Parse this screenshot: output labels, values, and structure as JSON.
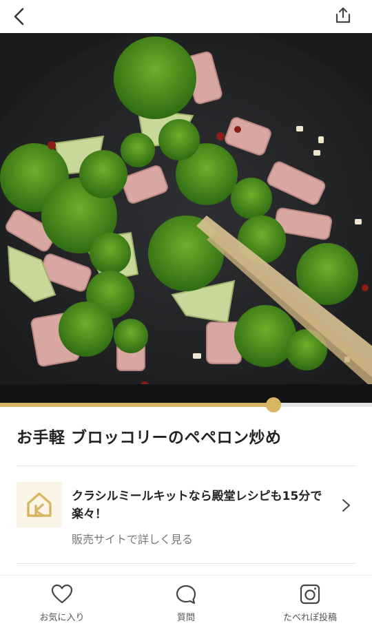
{
  "header": {
    "back_icon": "chevron-left-icon",
    "share_icon": "share-icon"
  },
  "video": {
    "description_icon": "recipe-video-frame",
    "progress": 0.735
  },
  "recipe": {
    "title": "お手軽 ブロッコリーのペペロン炒め"
  },
  "promo": {
    "logo_icon": "kurashiru-house-logo",
    "text": "クラシルミールキットなら殿堂レシピも15分で楽々！",
    "link_label": "販売サイトで詳しく見る",
    "chevron_icon": "chevron-right-icon"
  },
  "colors": {
    "accent": "#d8b563",
    "text": "#222222",
    "muted": "#777777"
  },
  "bottom_nav": {
    "items": [
      {
        "label": "お気に入り",
        "icon": "heart-icon"
      },
      {
        "label": "質問",
        "icon": "speech-bubble-icon"
      },
      {
        "label": "たべれぽ投稿",
        "icon": "camera-icon"
      }
    ]
  }
}
